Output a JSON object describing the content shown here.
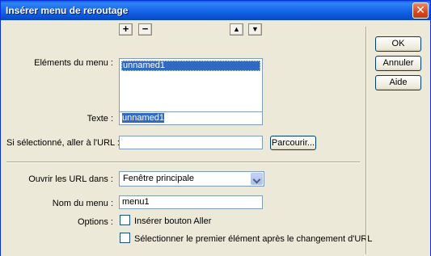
{
  "window": {
    "title": "Insérer menu de reroutage",
    "close_glyph": "✕"
  },
  "buttons": {
    "ok": "OK",
    "cancel": "Annuler",
    "help": "Aide",
    "browse": "Parcourir..."
  },
  "menu_items": {
    "label": "Eléments du menu :",
    "add_glyph": "+",
    "remove_glyph": "−",
    "move_up_glyph": "▲",
    "move_down_glyph": "▼",
    "items": [
      "unnamed1"
    ]
  },
  "text_field": {
    "label": "Texte :",
    "value": "unnamed1"
  },
  "url_field": {
    "label": "Si sélectionné, aller à l'URL :",
    "value": ""
  },
  "open_urls": {
    "label": "Ouvrir les URL dans :",
    "selected": "Fenêtre principale"
  },
  "menu_name": {
    "label": "Nom du menu :",
    "value": "menu1"
  },
  "options": {
    "label": "Options :",
    "go_button": {
      "label": "Insérer bouton Aller",
      "checked": false
    },
    "select_first": {
      "label": "Sélectionner le premier élément après le changement d'URL",
      "checked": false
    }
  }
}
